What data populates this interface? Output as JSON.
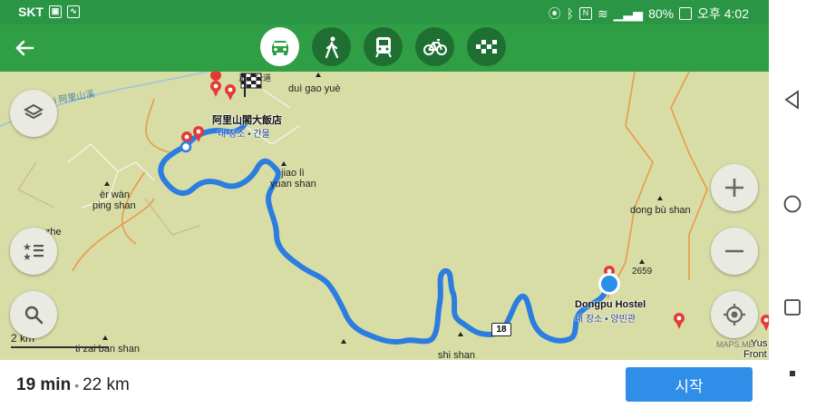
{
  "status": {
    "carrier": "SKT",
    "battery": "80%",
    "time": "오후 4:02"
  },
  "toolbar": {
    "back": "back-arrow-icon",
    "modes": [
      {
        "name": "car",
        "active": true
      },
      {
        "name": "walk",
        "active": false
      },
      {
        "name": "transit",
        "active": false
      },
      {
        "name": "bicycle",
        "active": false
      },
      {
        "name": "taxi",
        "active": false
      }
    ]
  },
  "map": {
    "labels": {
      "dui_gao_yue": "duì gao yuè",
      "er_wan": "èr wàn",
      "ping_shan": "ping shan",
      "jiao_li": "jiao lì",
      "yuan_shan": "yuan shan",
      "dong_bu_shan": "dong bù shan",
      "ping_zhe": "ping zhe",
      "shi_shan": "shi shan",
      "ti_zai_ban_shan": "ti zai ban shan",
      "elevation": "2659",
      "river": "ukan xi  阿里山溪",
      "top_cut": "正上公道"
    },
    "hotel_start": {
      "name": "阿里山閣大飯店",
      "sub": "내 장소 • 간물"
    },
    "hostel": {
      "name": "Dongpu Hostel",
      "sub": "내 장소 • 양빈관"
    },
    "right_edge": {
      "line1": "Yus",
      "line2": "Front"
    },
    "road_shield": "18",
    "scale": "2 km",
    "attribution": "MAPS.ME"
  },
  "route": {
    "duration": "19 min",
    "separator": "•",
    "distance": "22 km",
    "start_button": "시작"
  },
  "colors": {
    "status_bar": "#2a9544",
    "toolbar": "#2f9e44",
    "route": "#2b7de0",
    "map_bg": "#d8dda6",
    "start": "#2e8ee8"
  }
}
